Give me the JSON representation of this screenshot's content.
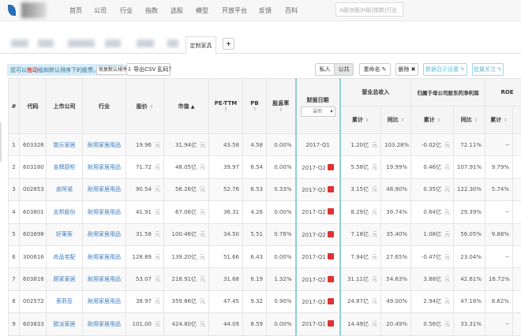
{
  "nav": {
    "items": [
      "首页",
      "公司",
      "行业",
      "指数",
      "选股",
      "模型",
      "开放平台",
      "反馈",
      "百科"
    ],
    "search_placeholder": "A股|B股|H股|指数|行业"
  },
  "tabs": {
    "active": "定制家具",
    "add": "+"
  },
  "toolbar": {
    "hint_pre": "您可以",
    "hint_red": "拖动",
    "hint_post": "组和默认排序下的股票。",
    "reset": "恢复默认排序",
    "export": "⇩ 导出CSV 乱码？",
    "private": "私人",
    "public": "公共",
    "rename": "重命名 ✎",
    "delete": "删除 ✖",
    "display": "数据显示设置 ✎",
    "batch": "批量关注 ✎"
  },
  "table": {
    "headers": {
      "idx": "#",
      "code": "代码",
      "company": "上市公司",
      "industry": "行业",
      "price": "股价",
      "cap": "市值",
      "pe": "PE-TTM",
      "pb": "PB",
      "div": "股息率",
      "date": "财报日期",
      "date_select": "最新",
      "rev": "营业总收入",
      "np": "归属于母公司股东的净利润",
      "roe": "ROE",
      "cum": "累计",
      "yoy": "同比"
    },
    "unit_yuan": "元",
    "rows": [
      {
        "i": "1",
        "code": "603326",
        "name": "我乐家居",
        "ind": "耐用家居用品",
        "price": "19.96",
        "cap": "31.94亿",
        "pe": "43.58",
        "pb": "4.58",
        "div": "0.00%",
        "date": "2017-Q1",
        "pdf": false,
        "rev": "1.20亿",
        "revy": "103.28%",
        "np": "-0.02亿",
        "npy": "72.11%",
        "roe": "--"
      },
      {
        "i": "2",
        "code": "603180",
        "name": "金牌厨柜",
        "ind": "耐用家居用品",
        "price": "71.72",
        "cap": "48.05亿",
        "pe": "39.97",
        "pb": "6.54",
        "div": "0.00%",
        "date": "2017-Q2",
        "pdf": true,
        "rev": "5.58亿",
        "revy": "19.99%",
        "np": "0.46亿",
        "npy": "107.91%",
        "roe": "9.79%"
      },
      {
        "i": "3",
        "code": "002853",
        "name": "皮阿诺",
        "ind": "耐用家居用品",
        "price": "90.54",
        "cap": "56.26亿",
        "pe": "52.76",
        "pb": "6.53",
        "div": "0.33%",
        "date": "2017-Q2",
        "pdf": true,
        "rev": "3.15亿",
        "revy": "48.90%",
        "np": "0.35亿",
        "npy": "122.30%",
        "roe": "5.74%"
      },
      {
        "i": "4",
        "code": "603801",
        "name": "志邦股份",
        "ind": "耐用家居用品",
        "price": "41.91",
        "cap": "67.06亿",
        "pe": "36.31",
        "pb": "4.26",
        "div": "0.00%",
        "date": "2017-Q2",
        "pdf": true,
        "rev": "8.29亿",
        "revy": "39.74%",
        "np": "0.64亿",
        "npy": "29.39%",
        "roe": "--"
      },
      {
        "i": "5",
        "code": "603898",
        "name": "好莱客",
        "ind": "耐用家居用品",
        "price": "31.58",
        "cap": "100.46亿",
        "pe": "34.50",
        "pb": "5.51",
        "div": "0.76%",
        "date": "2017-Q2",
        "pdf": true,
        "rev": "7.18亿",
        "revy": "35.40%",
        "np": "1.08亿",
        "npy": "56.05%",
        "roe": "9.88%"
      },
      {
        "i": "6",
        "code": "300616",
        "name": "尚品宅配",
        "ind": "耐用家居用品",
        "price": "128.89",
        "cap": "139.20亿",
        "pe": "51.66",
        "pb": "6.43",
        "div": "0.00%",
        "date": "2017-Q1",
        "pdf": true,
        "rev": "7.94亿",
        "revy": "27.65%",
        "np": "-0.47亿",
        "npy": "23.04%",
        "roe": "--"
      },
      {
        "i": "7",
        "code": "603816",
        "name": "顾家家居",
        "ind": "耐用家居用品",
        "price": "53.07",
        "cap": "218.91亿",
        "pe": "31.68",
        "pb": "6.19",
        "div": "1.32%",
        "date": "2017-Q2",
        "pdf": true,
        "rev": "31.11亿",
        "revy": "54.63%",
        "np": "3.88亿",
        "npy": "42.61%",
        "roe": "16.72%"
      },
      {
        "i": "8",
        "code": "002572",
        "name": "索菲亚",
        "ind": "耐用家居用品",
        "price": "38.97",
        "cap": "359.86亿",
        "pe": "47.45",
        "pb": "9.32",
        "div": "0.90%",
        "date": "2017-Q2",
        "pdf": true,
        "rev": "24.87亿",
        "revy": "49.00%",
        "np": "2.94亿",
        "npy": "47.16%",
        "roe": "8.62%"
      },
      {
        "i": "9",
        "code": "603833",
        "name": "欧派家居",
        "ind": "耐用家居用品",
        "price": "101.00",
        "cap": "424.80亿",
        "pe": "44.09",
        "pb": "8.59",
        "div": "0.00%",
        "date": "2017-Q1",
        "pdf": true,
        "rev": "14.49亿",
        "revy": "20.49%",
        "np": "0.56亿",
        "npy": "33.31%",
        "roe": "--"
      }
    ]
  }
}
